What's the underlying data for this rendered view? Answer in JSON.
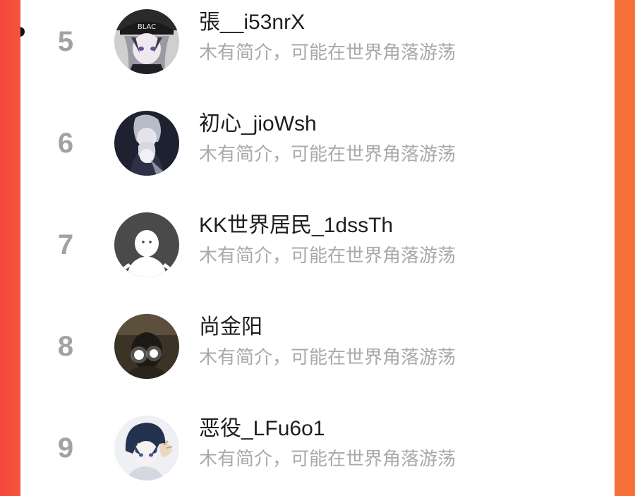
{
  "colors": {
    "background_accent": "#f5573a",
    "panel": "#ffffff",
    "rank": "#a2a2a2",
    "name": "#1e1e1e",
    "bio": "#a9a9a9"
  },
  "users": [
    {
      "rank": "5",
      "name": "張__i53nrX",
      "bio": "木有简介，可能在世界角落游荡",
      "avatar": "anime-boy-cap-avatar"
    },
    {
      "rank": "6",
      "name": "初心_jioWsh",
      "bio": "木有简介，可能在世界角落游荡",
      "avatar": "anime-couple-avatar"
    },
    {
      "rank": "7",
      "name": "KK世界居民_1dssTh",
      "bio": "木有简介，可能在世界角落游荡",
      "avatar": "default-user-avatar"
    },
    {
      "rank": "8",
      "name": "尚金阳",
      "bio": "木有简介，可能在世界角落游荡",
      "avatar": "dark-photo-avatar"
    },
    {
      "rank": "9",
      "name": "恶役_LFu6o1",
      "bio": "木有简介，可能在世界角落游荡",
      "avatar": "anime-boy-blue-hair-avatar"
    }
  ]
}
